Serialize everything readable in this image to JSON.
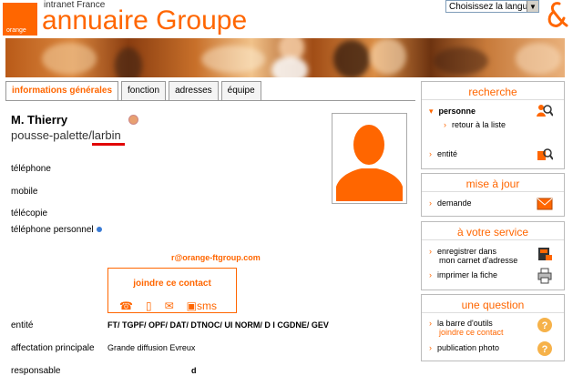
{
  "header": {
    "intranet_label": "intranet France",
    "app_title": "annuaire Groupe",
    "logo_text": "orange",
    "language_select": "Choisissez la langue"
  },
  "tabs": [
    {
      "label": "informations générales",
      "active": true
    },
    {
      "label": "fonction",
      "active": false
    },
    {
      "label": "adresses",
      "active": false
    },
    {
      "label": "équipe",
      "active": false
    }
  ],
  "person": {
    "name": "M. Thierry",
    "role": "pousse-palette/larbin"
  },
  "fields": {
    "telephone": "téléphone",
    "mobile": "mobile",
    "telecopie": "télécopie",
    "telephone_personnel": "téléphone personnel"
  },
  "email": "r@orange-ftgroup.com",
  "contact": {
    "title": "joindre ce contact",
    "sms": "sms"
  },
  "details": {
    "entite_label": "entité",
    "entite_value": "FT/ TGPF/ OPF/ DAT/ DTNOC/ UI NORM/ D I CGDNE/ GEV",
    "affectation_label": "affectation principale",
    "affectation_value": "Grande diffusion Evreux",
    "responsable_label": "responsable",
    "responsable_value": "d"
  },
  "sidebar": {
    "recherche": {
      "title": "recherche",
      "personne": "personne",
      "retour": "retour à la liste",
      "entite": "entité"
    },
    "mise_a_jour": {
      "title": "mise à jour",
      "demande": "demande"
    },
    "service": {
      "title": "à votre service",
      "enregistrer_line1": "enregistrer dans",
      "enregistrer_line2": "mon carnet d'adresse",
      "imprimer": "imprimer la fiche"
    },
    "question": {
      "title": "une question",
      "barre": "la barre d'outils",
      "joindre": "joindre ce contact",
      "publication": "publication photo"
    }
  },
  "colors": {
    "brand_orange": "#ff6600",
    "underline_red": "#e10000"
  }
}
